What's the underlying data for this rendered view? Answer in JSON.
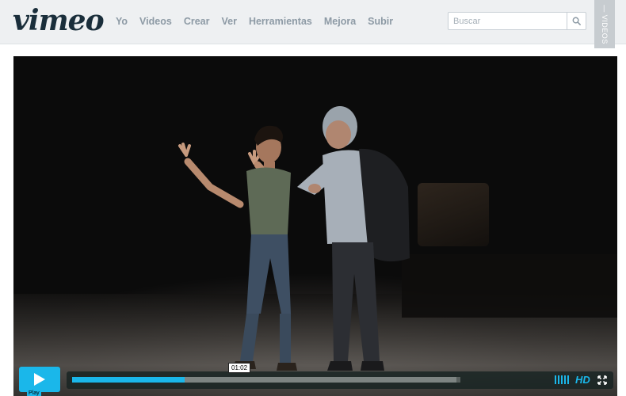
{
  "brand": {
    "logo": "vimeo"
  },
  "nav": {
    "items": [
      "Yo",
      "Videos",
      "Crear",
      "Ver",
      "Herramientas",
      "Mejora",
      "Subir"
    ]
  },
  "search": {
    "placeholder": "Buscar",
    "icon": "search-icon"
  },
  "side_tab": {
    "label": "— VIDEOS"
  },
  "player": {
    "play_label": "Play",
    "timecode": "01:02",
    "hd_label": "HD",
    "progress_played": 0.29,
    "progress_loaded": 0.99,
    "accent": "#1ab7ea",
    "icons": [
      "play-icon",
      "volume-icon",
      "fullscreen-icon"
    ]
  }
}
